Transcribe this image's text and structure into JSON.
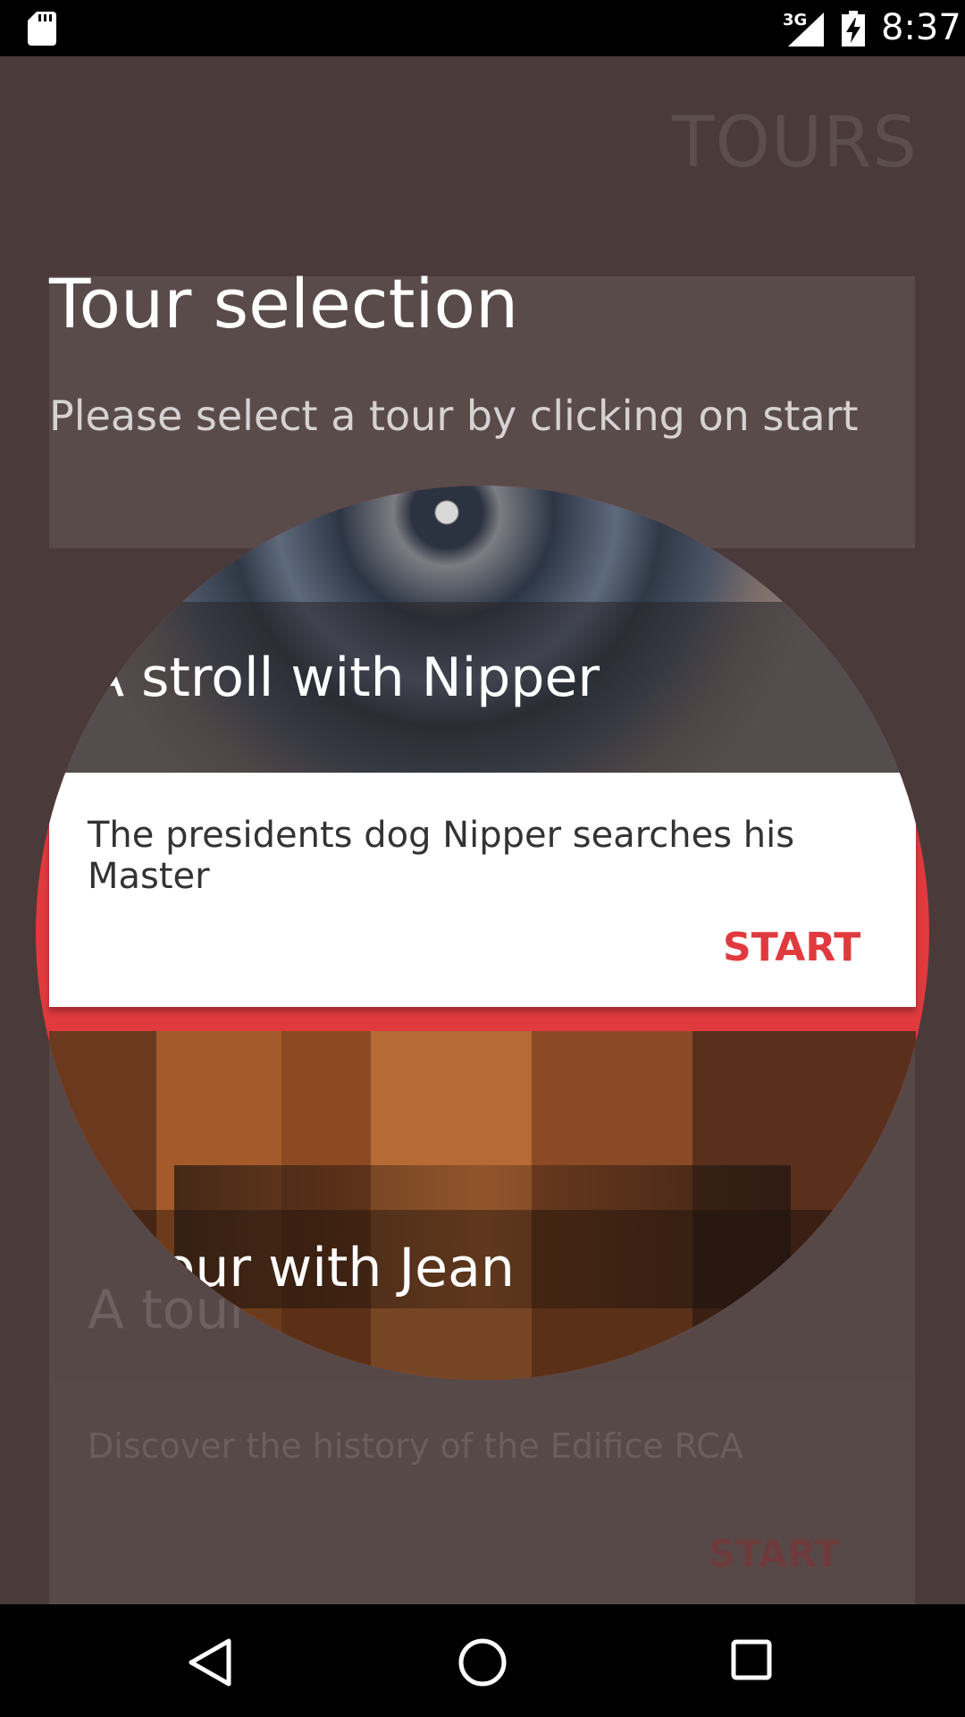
{
  "status_bar": {
    "network": "3G",
    "time": "8:37"
  },
  "app": {
    "title": "TOURS"
  },
  "dialog": {
    "title": "Tour selection",
    "subtitle": "Please select a tour by clicking on start"
  },
  "tours": [
    {
      "title": "A stroll with Nipper",
      "description": "The presidents dog Nipper searches his Master",
      "start_label": "START"
    },
    {
      "title": "A tour with Jean",
      "description": "Discover the history of the Edifice RCA",
      "start_label": "START"
    }
  ],
  "colors": {
    "accent": "#e03a3e",
    "background": "#4b3a3a"
  },
  "nav": {
    "back_icon": "back-icon",
    "home_icon": "home-icon",
    "recents_icon": "recents-icon"
  }
}
